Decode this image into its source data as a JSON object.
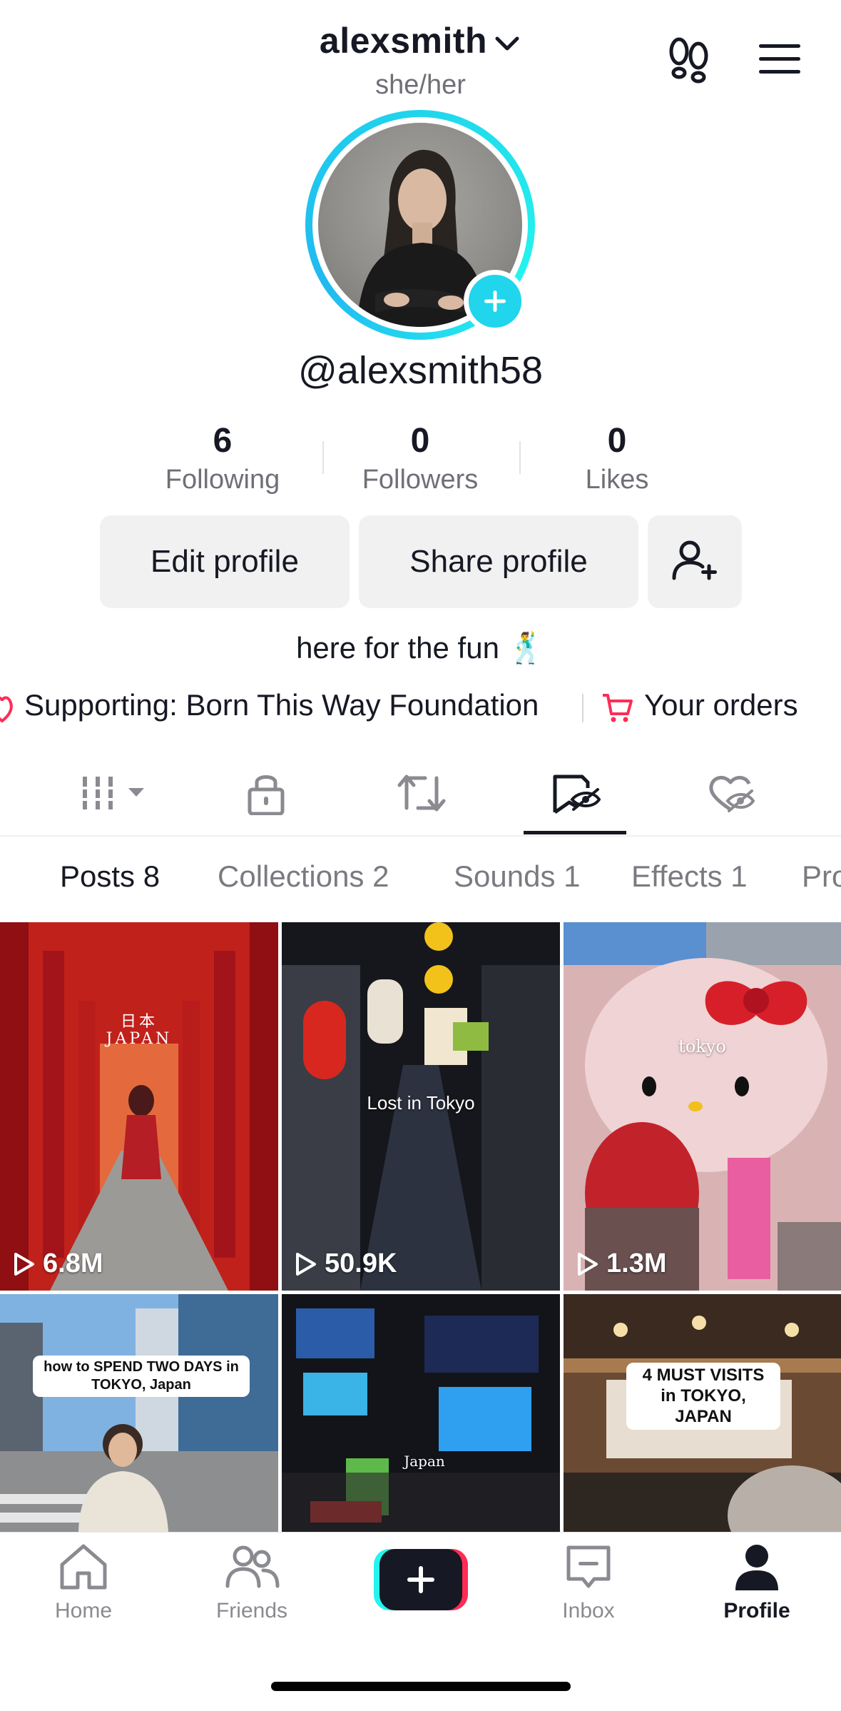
{
  "header": {
    "username": "alexsmith",
    "pronouns": "she/her",
    "handle": "@alexsmith58"
  },
  "stats": [
    {
      "value": "6",
      "label": "Following"
    },
    {
      "value": "0",
      "label": "Followers"
    },
    {
      "value": "0",
      "label": "Likes"
    }
  ],
  "buttons": {
    "edit": "Edit profile",
    "share": "Share profile"
  },
  "bio": "here for the fun 🕺",
  "links": {
    "supporting": "Supporting: Born This Way Foundation",
    "orders": "Your orders"
  },
  "icon_tabs": [
    "grid-icon",
    "lock-icon",
    "repost-icon",
    "saved-icon",
    "liked-icon"
  ],
  "sub_tabs": [
    "Posts 8",
    "Collections 2",
    "Sounds 1",
    "Effects 1",
    "Pro"
  ],
  "posts": [
    {
      "caption": "日本\nJAPAN",
      "views": "6.8M"
    },
    {
      "caption": "Lost in Tokyo",
      "views": "50.9K"
    },
    {
      "caption": "tokyo",
      "views": "1.3M"
    },
    {
      "caption": "how to SPEND TWO DAYS in TOKYO, Japan",
      "views": ""
    },
    {
      "caption": "Japan",
      "views": ""
    },
    {
      "caption": "4 MUST VISITS in TOKYO, JAPAN",
      "views": ""
    }
  ],
  "nav": [
    {
      "label": "Home"
    },
    {
      "label": "Friends"
    },
    {
      "label": "Inbox"
    },
    {
      "label": "Profile"
    }
  ],
  "colors": {
    "accent": "#20d5ec",
    "brand_red": "#fe2c55",
    "text": "#161823",
    "muted": "#6f7077"
  }
}
